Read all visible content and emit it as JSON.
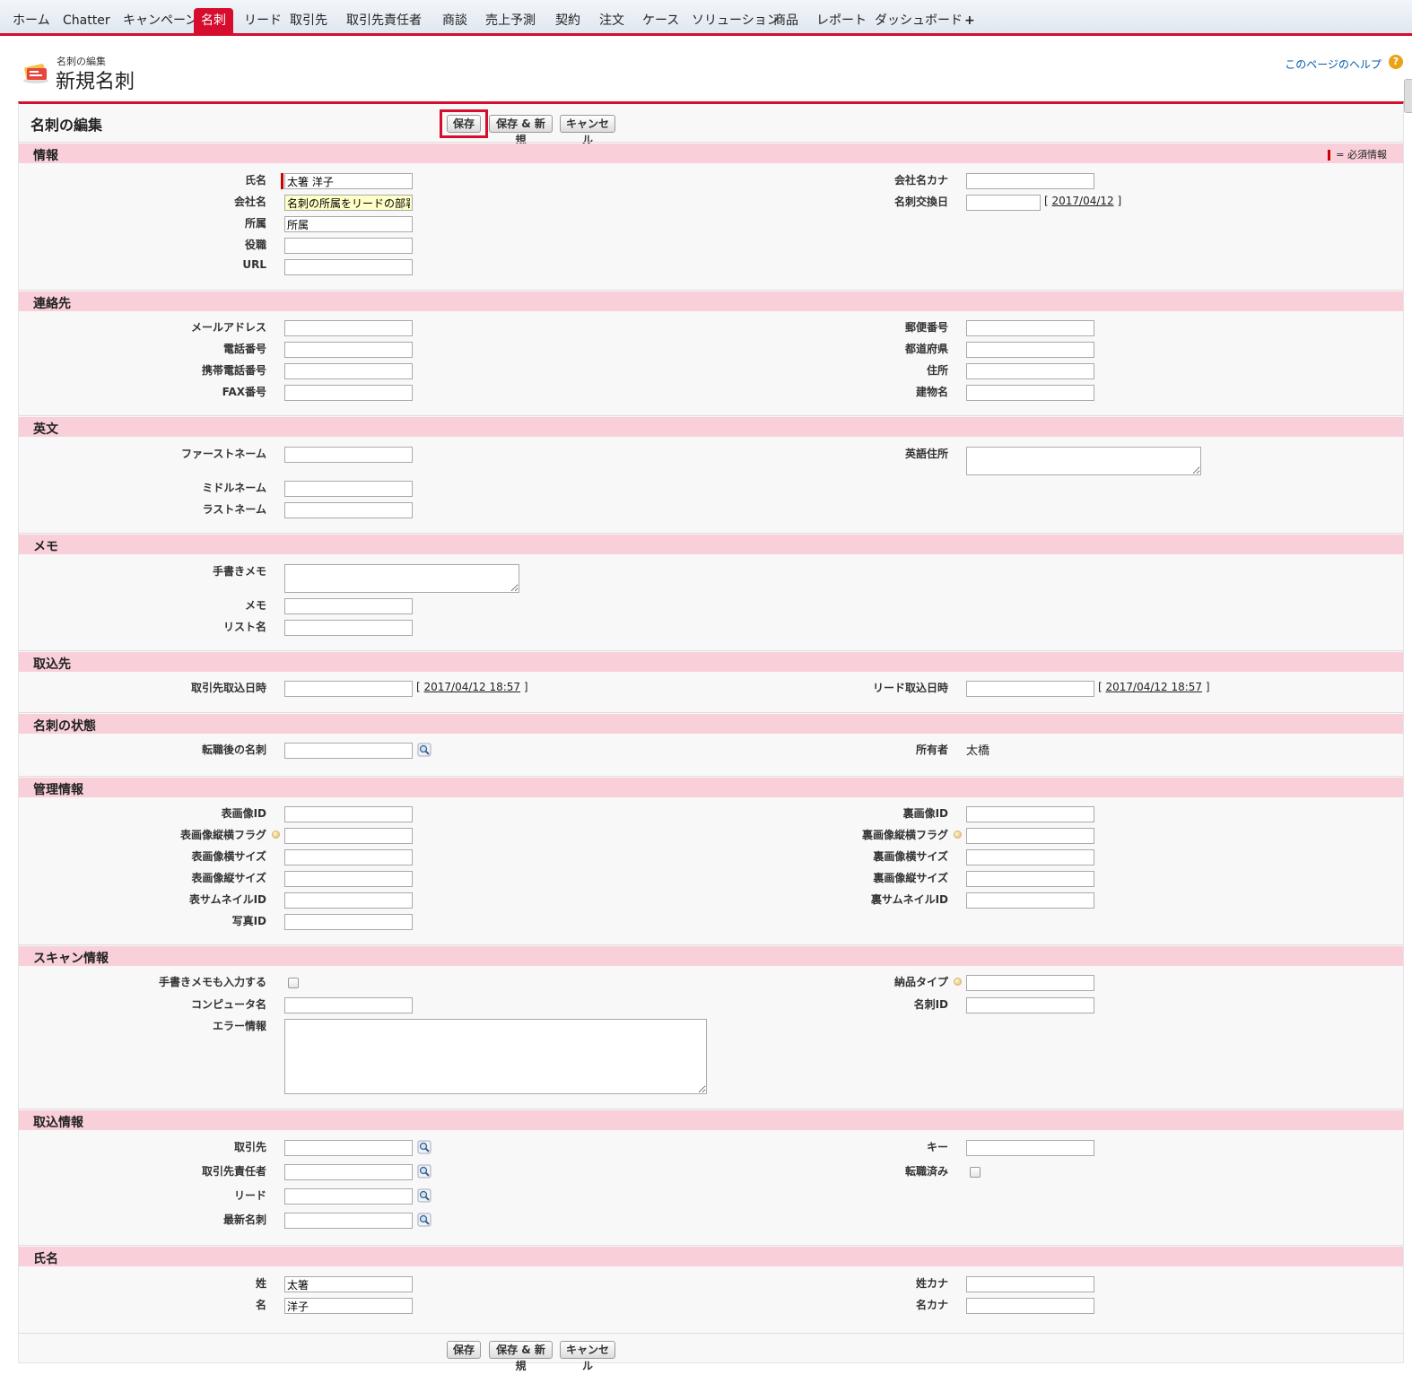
{
  "tabs": [
    "ホーム",
    "Chatter",
    "キャンペーン",
    "名刺",
    "リード",
    "取引先",
    "取引先責任者",
    "商談",
    "売上予測",
    "契約",
    "注文",
    "ケース",
    "ソリューション",
    "商品",
    "レポート",
    "ダッシュボード",
    "+"
  ],
  "active_tab": "名刺",
  "header": {
    "subtitle": "名刺の編集",
    "title": "新規名刺",
    "help": "このページのヘルプ",
    "help_icon_glyph": "?"
  },
  "panel": {
    "title": "名刺の編集",
    "save": "保存",
    "save_new": "保存 & 新規",
    "cancel": "キャンセル"
  },
  "required_legend": "= 必須情報",
  "sections": {
    "info": "情報",
    "contact": "連絡先",
    "english": "英文",
    "memo": "メモ",
    "import_dest": "取込先",
    "status": "名刺の状態",
    "admin": "管理情報",
    "scan": "スキャン情報",
    "import_info": "取込情報",
    "name": "氏名"
  },
  "fields": {
    "name": {
      "label": "氏名",
      "value": "太箸 洋子"
    },
    "company": {
      "label": "会社名",
      "value": "名刺の所属をリードの部署"
    },
    "dept": {
      "label": "所属",
      "value": "所属"
    },
    "title": {
      "label": "役職",
      "value": ""
    },
    "url": {
      "label": "URL",
      "value": ""
    },
    "company_kana": {
      "label": "会社名カナ",
      "value": ""
    },
    "exchange_date": {
      "label": "名刺交換日",
      "value": "",
      "today": "2017/04/12"
    },
    "email": {
      "label": "メールアドレス"
    },
    "phone": {
      "label": "電話番号"
    },
    "mobile": {
      "label": "携帯電話番号"
    },
    "fax": {
      "label": "FAX番号"
    },
    "zip": {
      "label": "郵便番号"
    },
    "prefecture": {
      "label": "都道府県"
    },
    "address": {
      "label": "住所"
    },
    "building": {
      "label": "建物名"
    },
    "first_name": {
      "label": "ファーストネーム"
    },
    "middle_name": {
      "label": "ミドルネーム"
    },
    "last_name": {
      "label": "ラストネーム"
    },
    "en_address": {
      "label": "英語住所"
    },
    "hand_memo": {
      "label": "手書きメモ"
    },
    "memo": {
      "label": "メモ"
    },
    "list_name": {
      "label": "リスト名"
    },
    "account_import_dt": {
      "label": "取引先取込日時",
      "now": "2017/04/12 18:57"
    },
    "lead_import_dt": {
      "label": "リード取込日時",
      "now": "2017/04/12 18:57"
    },
    "after_move_card": {
      "label": "転職後の名刺"
    },
    "owner": {
      "label": "所有者",
      "value": "太橋"
    },
    "front_image_id": {
      "label": "表画像ID"
    },
    "front_orient_flag": {
      "label": "表画像縦横フラグ"
    },
    "front_width": {
      "label": "表画像横サイズ"
    },
    "front_height": {
      "label": "表画像縦サイズ"
    },
    "front_thumb_id": {
      "label": "表サムネイルID"
    },
    "photo_id": {
      "label": "写真ID"
    },
    "back_image_id": {
      "label": "裏画像ID"
    },
    "back_orient_flag": {
      "label": "裏画像縦横フラグ"
    },
    "back_width": {
      "label": "裏画像横サイズ"
    },
    "back_height": {
      "label": "裏画像縦サイズ"
    },
    "back_thumb_id": {
      "label": "裏サムネイルID"
    },
    "input_hand_memo": {
      "label": "手書きメモも入力する"
    },
    "computer_name": {
      "label": "コンピュータ名"
    },
    "error_info": {
      "label": "エラー情報"
    },
    "delivery_type": {
      "label": "納品タイプ"
    },
    "card_id": {
      "label": "名刺ID"
    },
    "account": {
      "label": "取引先"
    },
    "contact": {
      "label": "取引先責任者"
    },
    "lead": {
      "label": "リード"
    },
    "latest_card": {
      "label": "最新名刺"
    },
    "key": {
      "label": "キー"
    },
    "moved": {
      "label": "転職済み"
    },
    "sei": {
      "label": "姓",
      "value": "太箸"
    },
    "mei": {
      "label": "名",
      "value": "洋子"
    },
    "sei_kana": {
      "label": "姓カナ",
      "value": ""
    },
    "mei_kana": {
      "label": "名カナ",
      "value": ""
    }
  }
}
